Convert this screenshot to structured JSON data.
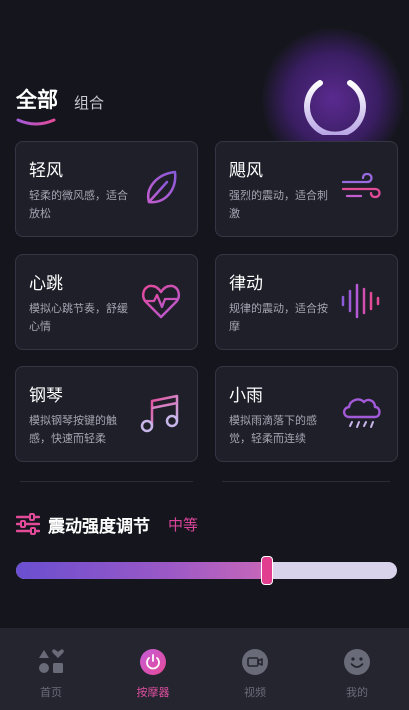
{
  "tabs": {
    "all": "全部",
    "combo": "组合"
  },
  "modes": [
    {
      "title": "轻风",
      "desc": "轻柔的微风感，适合放松",
      "icon": "leaf-icon"
    },
    {
      "title": "飓风",
      "desc": "强烈的震动，适合刺激",
      "icon": "wind-icon"
    },
    {
      "title": "心跳",
      "desc": "模拟心跳节奏，舒缓心情",
      "icon": "heartbeat-icon"
    },
    {
      "title": "律动",
      "desc": "规律的震动，适合按摩",
      "icon": "soundwave-icon"
    },
    {
      "title": "钢琴",
      "desc": "模拟钢琴按键的触感，快速而轻柔",
      "icon": "music-note-icon"
    },
    {
      "title": "小雨",
      "desc": "模拟雨滴落下的感觉，轻柔而连续",
      "icon": "rain-cloud-icon"
    }
  ],
  "intensity": {
    "title": "震动强度调节",
    "level": "中等",
    "value_fraction": 0.66
  },
  "nav": [
    {
      "label": "首页",
      "icon": "shapes-icon",
      "active": false
    },
    {
      "label": "按摩器",
      "icon": "power-icon",
      "active": true
    },
    {
      "label": "视频",
      "icon": "video-camera-icon",
      "active": false
    },
    {
      "label": "我的",
      "icon": "smiley-face-icon",
      "active": false
    }
  ],
  "colors": {
    "accent": "#d8449a",
    "purple": "#7b55d6",
    "background": "#15161d",
    "card": "#1e1f28"
  }
}
